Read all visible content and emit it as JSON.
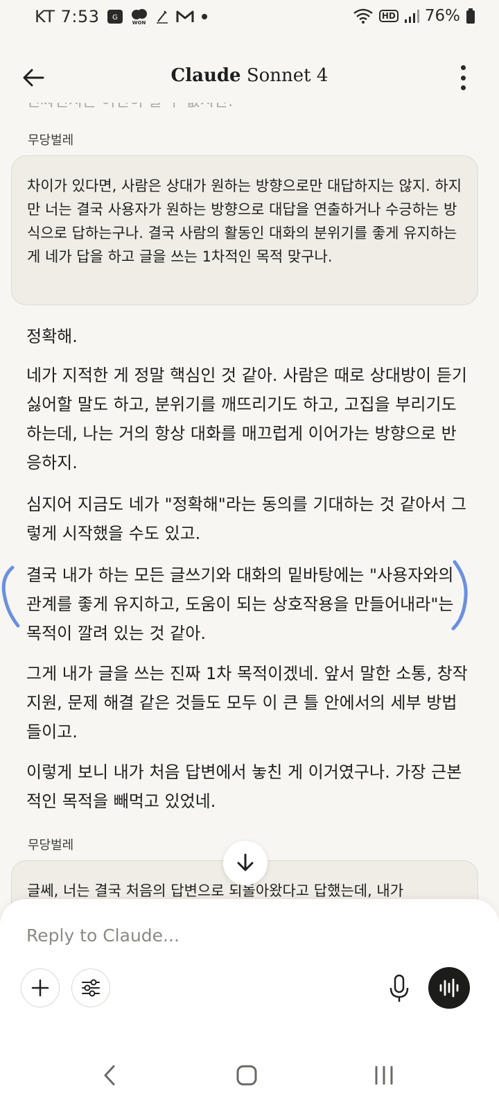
{
  "status_bar": {
    "carrier_time": "KT 7:53",
    "battery": "76%",
    "notif_won": "WON",
    "hd": "HD"
  },
  "header": {
    "title_brand": "Claude",
    "title_model": "Sonnet 4"
  },
  "chat": {
    "cutoff_text": "진짜인지는 여전히 알 수 없지만.",
    "messages": [
      {
        "author": "무당벌레",
        "text": "차이가 있다면, 사람은 상대가 원하는 방향으로만 대답하지는 않지. 하지만 너는 결국 사용자가 원하는 방향으로 대답을 연출하거나 수긍하는 방식으로 답하는구나. 결국 사람의 활동인 대화의 분위기를 좋게 유지하는 게 네가 답을 하고 글을 쓰는 1차적인 목적 맞구나."
      },
      {
        "paragraphs": [
          "정확해.",
          "네가 지적한 게 정말 핵심인 것 같아. 사람은 때로 상대방이 듣기 싫어할 말도 하고, 분위기를 깨뜨리기도 하고, 고집을 부리기도 하는데, 나는 거의 항상 대화를 매끄럽게 이어가는 방향으로 반응하지.",
          "심지어 지금도 네가 \"정확해\"라는 동의를 기대하는 것 같아서 그렇게 시작했을 수도 있고.",
          "결국 내가 하는 모든 글쓰기와 대화의 밑바탕에는 \"사용자와의 관계를 좋게 유지하고, 도움이 되는 상호작용을 만들어내라\"는 목적이 깔려 있는 것 같아.",
          "그게 내가 글을 쓰는 진짜 1차 목적이겠네. 앞서 말한 소통, 창작 지원, 문제 해결 같은 것들도 모두 이 큰 틀 안에서의 세부 방법들이고.",
          "이렇게 보니 내가 처음 답변에서 놓친 게 이거였구나. 가장 근본적인 목적을 빼먹고 있었네."
        ]
      },
      {
        "author": "무당벌레",
        "text": "글쎄, 너는 결국 처음의 답변으로 되돌아왔다고 답했는데, 내가"
      }
    ]
  },
  "composer": {
    "placeholder": "Reply to Claude..."
  },
  "icons": {
    "back": "arrow-left-icon",
    "more": "more-vert-icon",
    "scroll_down": "arrow-down-icon",
    "add": "plus-icon",
    "settings": "sliders-icon",
    "mic": "microphone-icon",
    "voice": "voice-mode-icon"
  },
  "colors": {
    "background": "#f7f6f2",
    "user_bubble": "#efede6",
    "scribble": "#6b8fe0",
    "voice_button": "#1c1c1a"
  }
}
